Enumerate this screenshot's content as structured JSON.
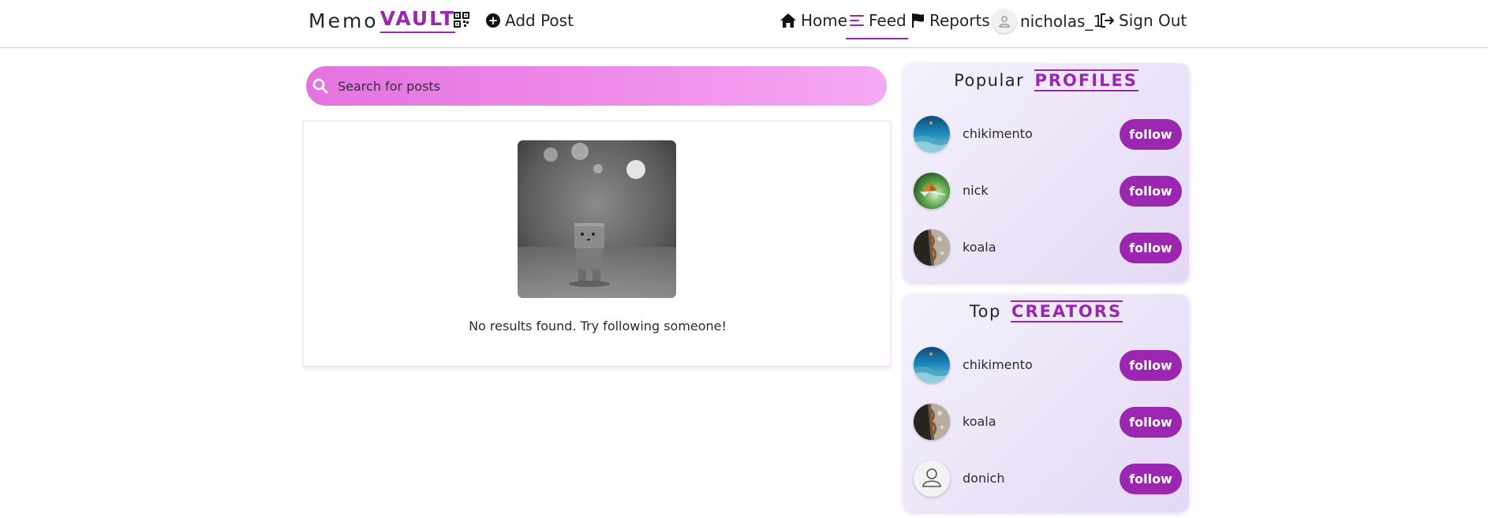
{
  "brand": {
    "part1": "Memo",
    "part2": "VAULT",
    "accent_color": "#9b27b0"
  },
  "nav": {
    "qr_icon": "qr-code-icon",
    "add_post": "Add Post",
    "home": "Home",
    "feed": "Feed",
    "reports": "Reports",
    "username": "nicholas_1",
    "sign_out": "Sign Out",
    "active": "Feed"
  },
  "search": {
    "placeholder": "Search for posts",
    "value": ""
  },
  "feed": {
    "empty_message": "No results found. Try following someone!"
  },
  "popular_profiles": {
    "title_plain": "Popular",
    "title_accent": "PROFILES",
    "items": [
      {
        "name": "chikimento",
        "avatar": "ocean-avatar",
        "action": "follow"
      },
      {
        "name": "nick",
        "avatar": "butterfly-avatar",
        "action": "follow"
      },
      {
        "name": "koala",
        "avatar": "tree-bark-avatar",
        "action": "follow"
      }
    ]
  },
  "top_creators": {
    "title_plain": "Top",
    "title_accent": "CREATORS",
    "items": [
      {
        "name": "chikimento",
        "avatar": "ocean-avatar",
        "action": "follow"
      },
      {
        "name": "koala",
        "avatar": "tree-bark-avatar",
        "action": "follow"
      },
      {
        "name": "donich",
        "avatar": "default-user-avatar",
        "action": "follow"
      }
    ]
  }
}
